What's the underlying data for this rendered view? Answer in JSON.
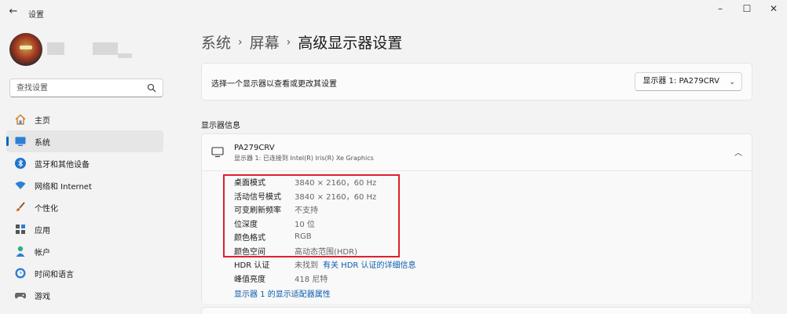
{
  "window": {
    "title": "设置",
    "back": "←",
    "minimize": "–",
    "maximize": "☐",
    "close": "✕"
  },
  "sidebar": {
    "search_placeholder": "查找设置",
    "items": [
      {
        "label": "主页",
        "icon": "home-icon"
      },
      {
        "label": "系统",
        "icon": "system-icon",
        "active": true
      },
      {
        "label": "蓝牙和其他设备",
        "icon": "bluetooth-icon"
      },
      {
        "label": "网络和 Internet",
        "icon": "wifi-icon"
      },
      {
        "label": "个性化",
        "icon": "brush-icon"
      },
      {
        "label": "应用",
        "icon": "apps-icon"
      },
      {
        "label": "帐户",
        "icon": "account-icon"
      },
      {
        "label": "时间和语言",
        "icon": "clock-globe-icon"
      },
      {
        "label": "游戏",
        "icon": "gamepad-icon"
      }
    ]
  },
  "breadcrumb": {
    "items": [
      "系统",
      "屏幕",
      "高级显示器设置"
    ],
    "separator": "›"
  },
  "select_display": {
    "text": "选择一个显示器以查看或更改其设置",
    "dropdown_value": "显示器 1: PA279CRV",
    "chevron": "⌄"
  },
  "display_info": {
    "section_title": "显示器信息",
    "monitor_name": "PA279CRV",
    "monitor_sub": "显示器 1: 已连接到 Intel(R) Iris(R) Xe Graphics",
    "collapse": "︿",
    "rows": [
      {
        "label": "桌面模式",
        "value": "3840 × 2160，60 Hz"
      },
      {
        "label": "活动信号模式",
        "value": "3840 × 2160，60 Hz"
      },
      {
        "label": "可变刷新频率",
        "value": "不支持"
      },
      {
        "label": "位深度",
        "value": "10 位"
      },
      {
        "label": "颜色格式",
        "value": "RGB"
      },
      {
        "label": "颜色空间",
        "value": "高动态范围(HDR)"
      },
      {
        "label": "HDR 认证",
        "value": "未找到",
        "link": "有关 HDR 认证的详细信息"
      },
      {
        "label": "峰值亮度",
        "value": "418 尼特"
      }
    ],
    "adapter_link": "显示器 1 的显示适配器属性"
  },
  "colors": {
    "accent": "#0067c0",
    "link": "#0b5cad",
    "highlight": "#e0202a"
  }
}
